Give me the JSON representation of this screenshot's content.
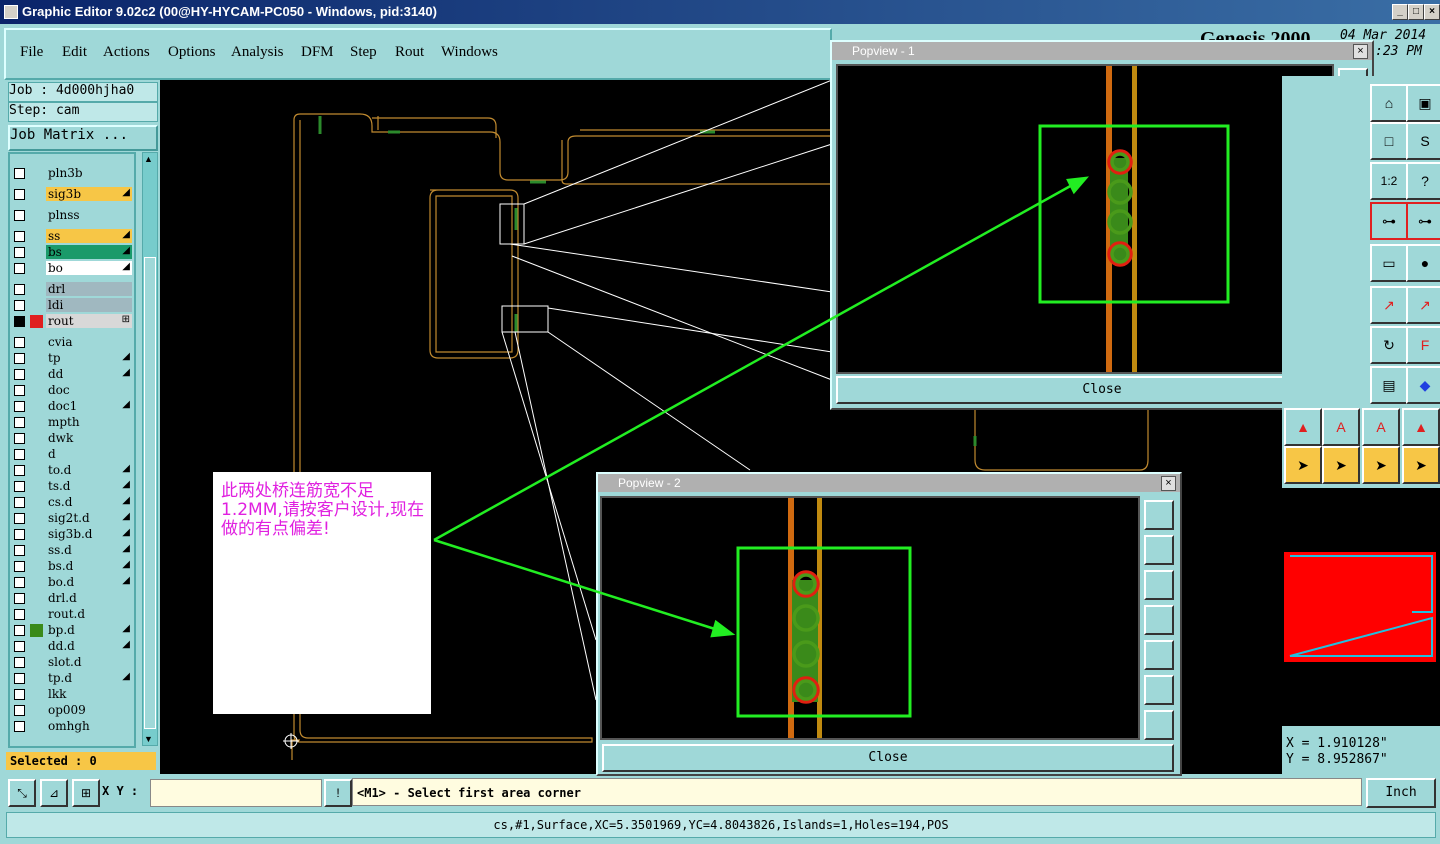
{
  "window": {
    "title": "Graphic Editor 9.02c2 (00@HY-HYCAM-PC050 - Windows, pid:3140)"
  },
  "menu": [
    "File",
    "Edit",
    "Actions",
    "Options",
    "Analysis",
    "DFM",
    "Step",
    "Rout",
    "Windows"
  ],
  "genesis": {
    "brand": "Genesis 2000",
    "date": "04 Mar 2014",
    "time": ":23 PM"
  },
  "job": {
    "job_label": "Job : 4d000hjha0",
    "step_label": "Step: cam",
    "matrix_button": "Job Matrix ..."
  },
  "layers": [
    {
      "name": "pln3b",
      "color": "#9fd8d8",
      "mark": ""
    },
    {
      "name": "sig3b",
      "color": "#f7c646",
      "mark": "◢"
    },
    {
      "name": "plnss",
      "color": "#9fd8d8",
      "mark": ""
    },
    {
      "name": "ss",
      "color": "#f7c646",
      "mark": "◢"
    },
    {
      "name": "bs",
      "color": "#1a9a6a",
      "mark": "◢"
    },
    {
      "name": "bo",
      "color": "#ffffff",
      "mark": "◢"
    },
    {
      "name": "drl",
      "color": "#a0b8c0",
      "mark": ""
    },
    {
      "name": "ldi",
      "color": "#a0b8c0",
      "mark": ""
    },
    {
      "name": "rout",
      "color": "#d8d8d8",
      "mark": "⊞"
    },
    {
      "name": "cvia",
      "color": "#9fd8d8",
      "mark": ""
    },
    {
      "name": "tp",
      "color": "#9fd8d8",
      "mark": "◢"
    },
    {
      "name": "dd",
      "color": "#9fd8d8",
      "mark": "◢"
    },
    {
      "name": "doc",
      "color": "#9fd8d8",
      "mark": ""
    },
    {
      "name": "doc1",
      "color": "#9fd8d8",
      "mark": "◢"
    },
    {
      "name": "mpth",
      "color": "#9fd8d8",
      "mark": ""
    },
    {
      "name": "dwk",
      "color": "#9fd8d8",
      "mark": ""
    },
    {
      "name": "d",
      "color": "#9fd8d8",
      "mark": ""
    },
    {
      "name": "to.d",
      "color": "#9fd8d8",
      "mark": "◢"
    },
    {
      "name": "ts.d",
      "color": "#9fd8d8",
      "mark": "◢"
    },
    {
      "name": "cs.d",
      "color": "#9fd8d8",
      "mark": "◢"
    },
    {
      "name": "sig2t.d",
      "color": "#9fd8d8",
      "mark": "◢"
    },
    {
      "name": "sig3b.d",
      "color": "#9fd8d8",
      "mark": "◢"
    },
    {
      "name": "ss.d",
      "color": "#9fd8d8",
      "mark": "◢"
    },
    {
      "name": "bs.d",
      "color": "#9fd8d8",
      "mark": "◢"
    },
    {
      "name": "bo.d",
      "color": "#9fd8d8",
      "mark": "◢"
    },
    {
      "name": "drl.d",
      "color": "#9fd8d8",
      "mark": ""
    },
    {
      "name": "rout.d",
      "color": "#9fd8d8",
      "mark": ""
    },
    {
      "name": "bp.d",
      "color": "#9fd8d8",
      "mark": "◢"
    },
    {
      "name": "dd.d",
      "color": "#9fd8d8",
      "mark": "◢"
    },
    {
      "name": "slot.d",
      "color": "#9fd8d8",
      "mark": ""
    },
    {
      "name": "tp.d",
      "color": "#9fd8d8",
      "mark": "◢"
    },
    {
      "name": "lkk",
      "color": "#9fd8d8",
      "mark": ""
    },
    {
      "name": "op009",
      "color": "#9fd8d8",
      "mark": ""
    },
    {
      "name": "omhgh",
      "color": "#9fd8d8",
      "mark": ""
    }
  ],
  "selected": "Selected : 0",
  "popview1": {
    "title": "Popview - 1",
    "close": "Close"
  },
  "popview2": {
    "title": "Popview - 2",
    "close": "Close"
  },
  "note": "此两处桥连筋宽不足1.2MM,请按客户设计,现在做的有点偏差!",
  "coords": {
    "x": "X = 1.910128\"",
    "y": "Y = 8.952867\""
  },
  "command": {
    "xy_label": "X Y :",
    "xy_value": "",
    "prompt": "<M1> - Select first area corner",
    "unit": "Inch"
  },
  "status": "cs,#1,Surface,XC=5.3501969,YC=4.8043826,Islands=1,Holes=194,POS",
  "colors": {
    "title_bg": "#0a246a",
    "panel": "#9fd8d8",
    "canvas": "#000000",
    "trace": "#c08a30",
    "highlight": "#22ee22",
    "note_text": "#e020e0",
    "minimap": "#ff0000"
  }
}
